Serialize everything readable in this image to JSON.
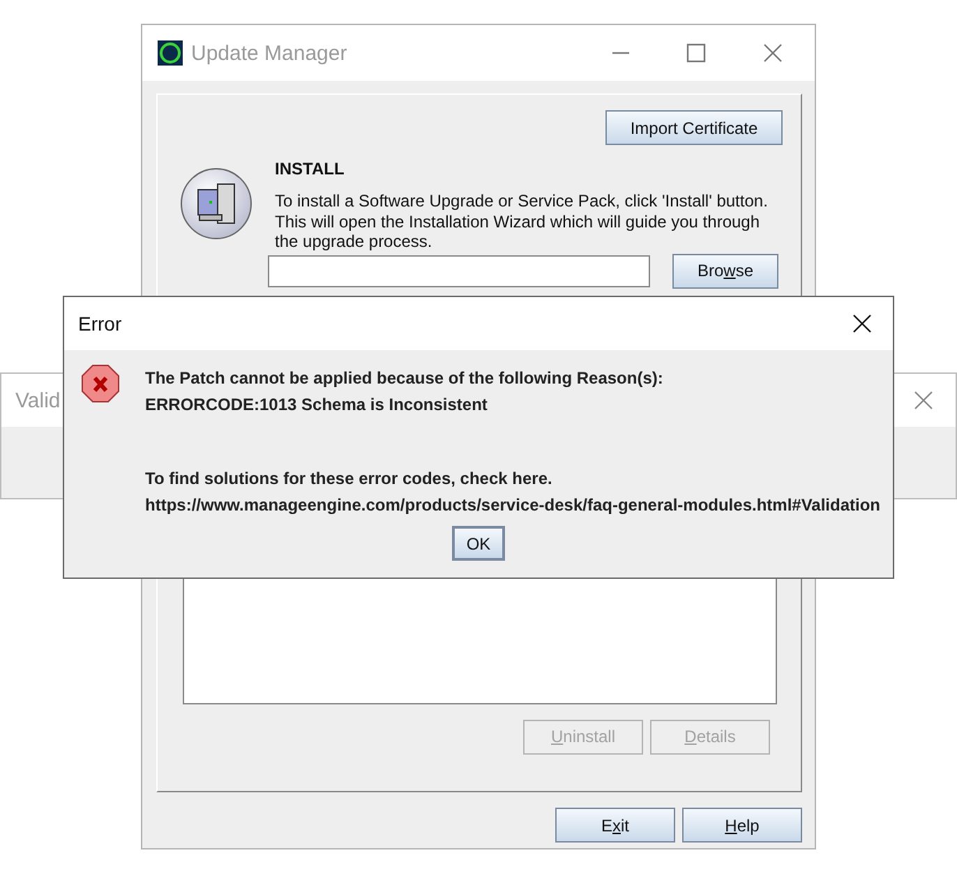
{
  "background_window": {
    "title": "Valid"
  },
  "main_window": {
    "title": "Update Manager",
    "import_button": "Import Certificate",
    "install": {
      "heading": "INSTALL",
      "description": "To install a Software Upgrade or Service Pack, click 'Install' button. This will open the Installation Wizard which will guide you through the upgrade process.",
      "browse_button": {
        "label": [
          {
            "text": "Bro",
            "underlined": false
          },
          {
            "text": "w",
            "underlined": true
          },
          {
            "text": "se",
            "underlined": false
          }
        ]
      }
    },
    "list_buttons": [
      {
        "label": [
          {
            "text": "U",
            "underlined": true
          },
          {
            "text": "ninstall",
            "underlined": false
          }
        ],
        "disabled": true
      },
      {
        "label": [
          {
            "text": "D",
            "underlined": true
          },
          {
            "text": "etails",
            "underlined": false
          }
        ],
        "disabled": true
      }
    ],
    "footer_buttons": [
      {
        "label": [
          {
            "text": "E",
            "underlined": false
          },
          {
            "text": "x",
            "underlined": true
          },
          {
            "text": "it",
            "underlined": false
          }
        ],
        "disabled": false
      },
      {
        "label": [
          {
            "text": "H",
            "underlined": true
          },
          {
            "text": "elp",
            "underlined": false
          }
        ],
        "disabled": false
      }
    ]
  },
  "error_dialog": {
    "title": "Error",
    "reason_lines": [
      "The Patch cannot be applied because of the following Reason(s):",
      "ERRORCODE:1013 Schema is Inconsistent"
    ],
    "help_lines": [
      "To find solutions for these error codes, check here.",
      "https://www.manageengine.com/products/service-desk/faq-general-modules.html#Validation"
    ],
    "ok_button": "OK"
  }
}
